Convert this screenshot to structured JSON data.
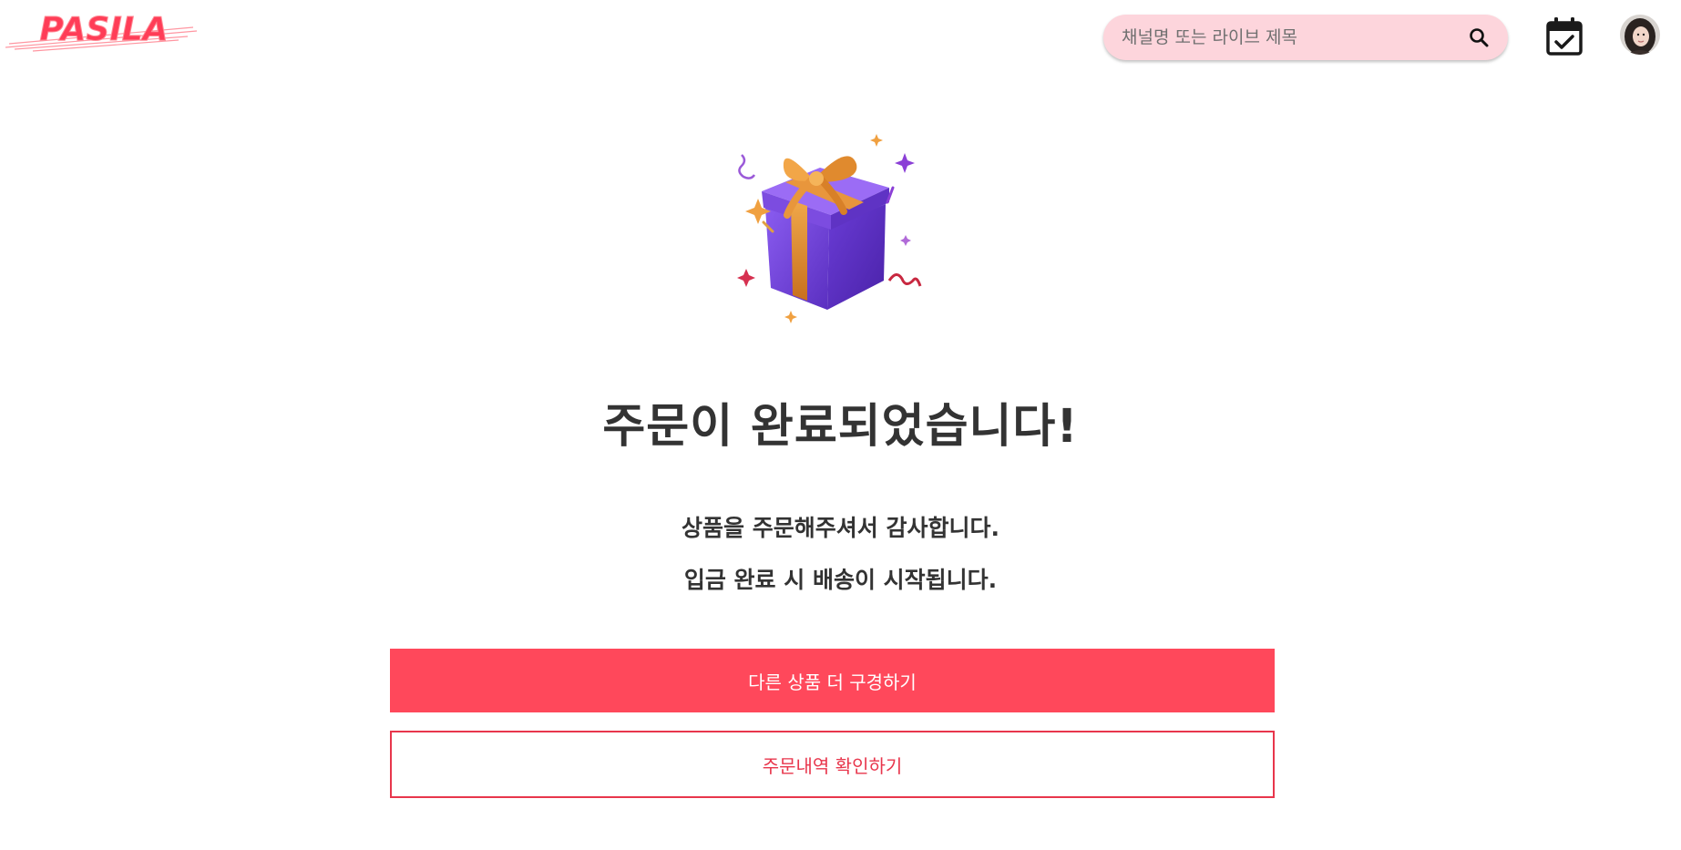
{
  "header": {
    "logo_text": "PASILA",
    "search": {
      "placeholder": "채널명 또는 라이브 제목",
      "value": ""
    },
    "icons": {
      "search": "search-icon",
      "calendar": "calendar-check-icon",
      "profile": "avatar"
    }
  },
  "main": {
    "illustration": "gift-box-icon",
    "title": "주문이 완료되었습니다!",
    "messages": [
      "상품을 주문해주셔서 감사합니다.",
      "입금 완료 시 배송이 시작됩니다."
    ],
    "primary_button_label": "다른 상품 더 구경하기",
    "secondary_button_label": "주문내역 확인하기"
  },
  "colors": {
    "accent": "#ff485b",
    "accent_border": "#e8364c",
    "search_bg": "#fdd5dc",
    "text": "#333333",
    "gift_box": "#7b4fd8",
    "ribbon": "#e0923a"
  }
}
